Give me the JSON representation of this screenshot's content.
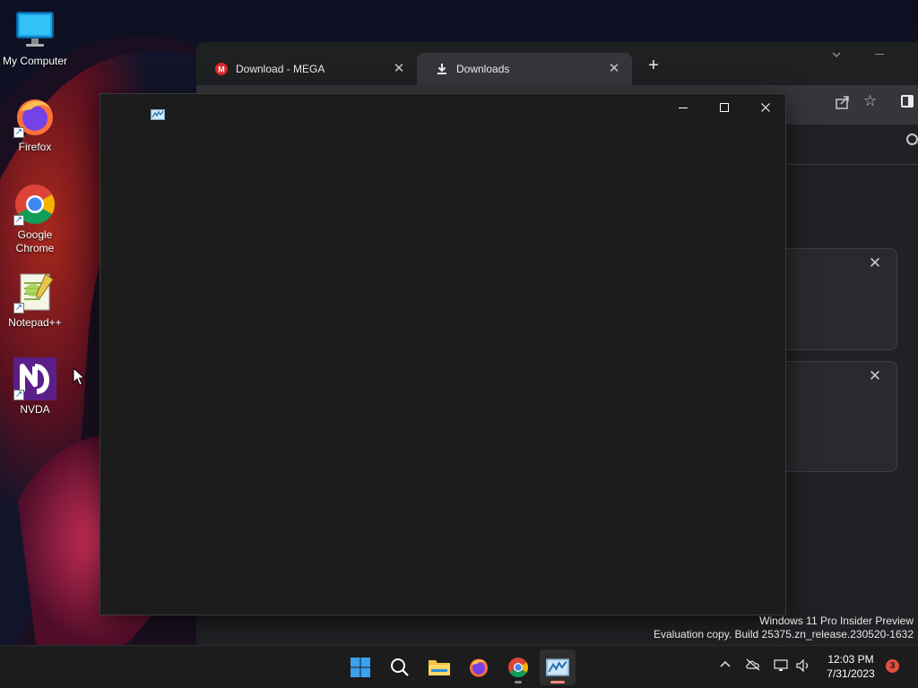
{
  "desktop": {
    "icons": [
      {
        "label": "My Computer",
        "icon": "monitor-icon"
      },
      {
        "label": "Firefox",
        "icon": "firefox-icon"
      },
      {
        "label": "Google Chrome",
        "icon": "chrome-icon"
      },
      {
        "label": "Notepad++",
        "icon": "notepadpp-icon"
      },
      {
        "label": "NVDA",
        "icon": "nvda-icon"
      }
    ]
  },
  "browser": {
    "tabs": [
      {
        "title": "Download - MEGA",
        "icon": "mega-icon",
        "close": "✕"
      },
      {
        "title": "Downloads",
        "icon": "download-icon",
        "close": "✕"
      }
    ],
    "new_tab": "+",
    "download_close": "✕"
  },
  "app_window": {
    "minimize": "—",
    "maximize": "☐",
    "close": "✕"
  },
  "watermark": {
    "line1": "Windows 11 Pro Insider Preview",
    "line2": "Evaluation copy. Build 25375.zn_release.230520-1632"
  },
  "taskbar": {
    "time": "12:03 PM",
    "date": "7/31/2023",
    "notification_count": "3"
  },
  "colors": {
    "accent": "#0078d4",
    "taskbar": "#1c1c1c",
    "window": "#1c1c1c"
  }
}
